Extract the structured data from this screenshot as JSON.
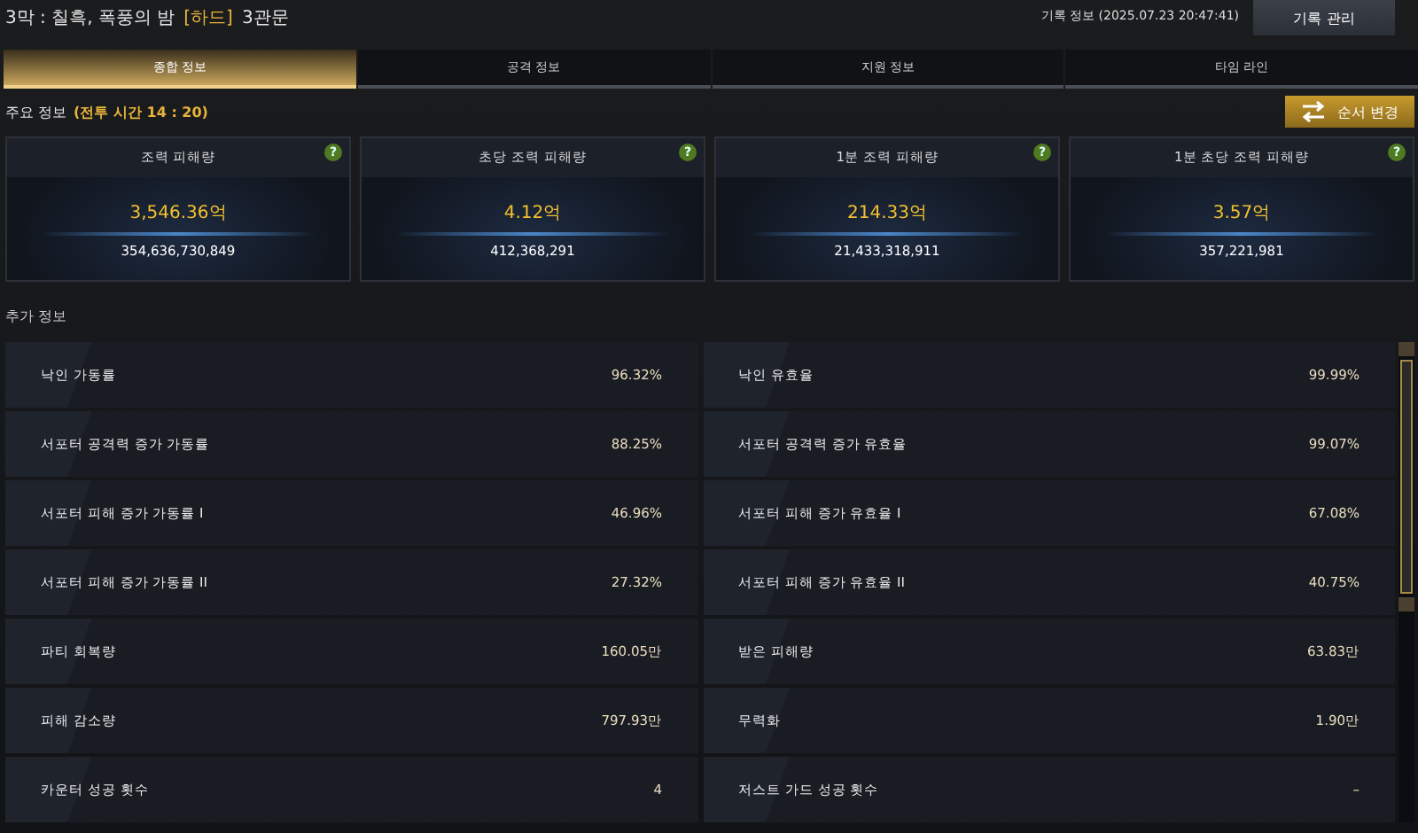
{
  "header": {
    "title": "3막 : 칠흑, 폭풍의 밤",
    "difficulty": "[하드]",
    "stage": "3관문",
    "record_info": "기록 정보 (2025.07.23 20:47:41)",
    "manage_button": "기록 관리"
  },
  "tabs": [
    {
      "label": "종합 정보",
      "selected": true
    },
    {
      "label": "공격 정보",
      "selected": false
    },
    {
      "label": "지원 정보",
      "selected": false
    },
    {
      "label": "타임 라인",
      "selected": false
    }
  ],
  "main_section": {
    "title": "주요 정보",
    "battle_time": "(전투 시간 14 : 20)",
    "order_button": "순서 변경"
  },
  "cards": [
    {
      "title": "조력 피해량",
      "value": "3,546.36억",
      "exact": "354,636,730,849",
      "help": "?"
    },
    {
      "title": "초당 조력 피해량",
      "value": "4.12억",
      "exact": "412,368,291",
      "help": "?"
    },
    {
      "title": "1분 조력 피해량",
      "value": "214.33억",
      "exact": "21,433,318,911",
      "help": "?"
    },
    {
      "title": "1분 초당 조력 피해량",
      "value": "3.57억",
      "exact": "357,221,981",
      "help": "?"
    }
  ],
  "extra_section": {
    "title": "추가 정보"
  },
  "stats": [
    {
      "label": "낙인 가동률",
      "value": "96.32%"
    },
    {
      "label": "낙인 유효율",
      "value": "99.99%"
    },
    {
      "label": "서포터 공격력 증가 가동률",
      "value": "88.25%"
    },
    {
      "label": "서포터 공격력 증가 유효율",
      "value": "99.07%"
    },
    {
      "label": "서포터 피해 증가 가동률 I",
      "value": "46.96%"
    },
    {
      "label": "서포터 피해 증가 유효율 I",
      "value": "67.08%"
    },
    {
      "label": "서포터 피해 증가 가동률 II",
      "value": "27.32%"
    },
    {
      "label": "서포터 피해 증가 유효율 II",
      "value": "40.75%"
    },
    {
      "label": "파티 회복량",
      "value": "160.05만"
    },
    {
      "label": "받은 피해량",
      "value": "63.83만"
    },
    {
      "label": "피해 감소량",
      "value": "797.93만"
    },
    {
      "label": "무력화",
      "value": "1.90만"
    },
    {
      "label": "카운터 성공 횟수",
      "value": "4"
    },
    {
      "label": "저스트 가드 성공 횟수",
      "value": "–"
    }
  ]
}
